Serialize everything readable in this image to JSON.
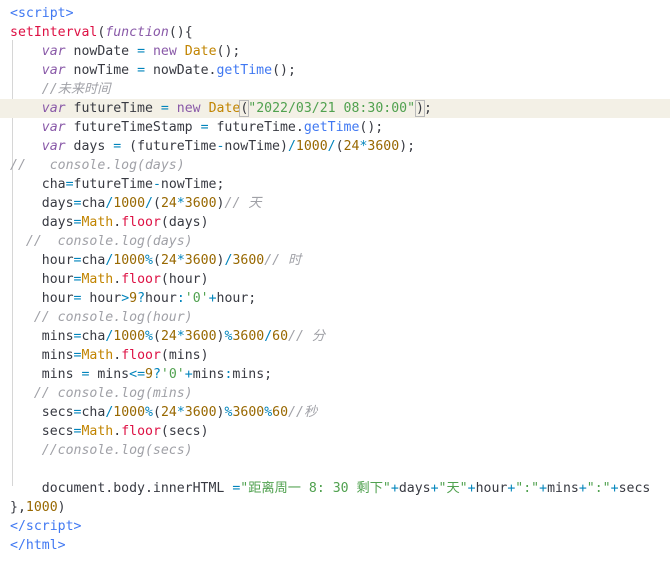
{
  "editor": {
    "language": "html",
    "cursor_line": 6,
    "lines": [
      [
        {
          "t": "<script>",
          "c": "tag"
        }
      ],
      [
        {
          "t": "setInterval",
          "c": "fn"
        },
        {
          "t": "(",
          "c": "plain"
        },
        {
          "t": "function",
          "c": "ital"
        },
        {
          "t": "(){",
          "c": "plain"
        }
      ],
      [
        {
          "t": "    ",
          "c": "plain"
        },
        {
          "t": "var",
          "c": "ital"
        },
        {
          "t": " nowDate ",
          "c": "plain"
        },
        {
          "t": "=",
          "c": "op"
        },
        {
          "t": " ",
          "c": "plain"
        },
        {
          "t": "new",
          "c": "kw"
        },
        {
          "t": " ",
          "c": "plain"
        },
        {
          "t": "Date",
          "c": "cls"
        },
        {
          "t": "();",
          "c": "plain"
        }
      ],
      [
        {
          "t": "    ",
          "c": "plain"
        },
        {
          "t": "var",
          "c": "ital"
        },
        {
          "t": " nowTime ",
          "c": "plain"
        },
        {
          "t": "=",
          "c": "op"
        },
        {
          "t": " nowDate.",
          "c": "plain"
        },
        {
          "t": "getTime",
          "c": "meth"
        },
        {
          "t": "();",
          "c": "plain"
        }
      ],
      [
        {
          "t": "    ",
          "c": "plain"
        },
        {
          "t": "//未来时间",
          "c": "cm"
        }
      ],
      [
        {
          "t": "    ",
          "c": "plain"
        },
        {
          "t": "var",
          "c": "ital"
        },
        {
          "t": " futureTime ",
          "c": "plain"
        },
        {
          "t": "=",
          "c": "op"
        },
        {
          "t": " ",
          "c": "plain"
        },
        {
          "t": "new",
          "c": "kw"
        },
        {
          "t": " ",
          "c": "plain"
        },
        {
          "t": "Date",
          "c": "cls"
        },
        {
          "t": "(",
          "c": "plain",
          "m": 1
        },
        {
          "t": "\"2022/03/21 08:30:00\"",
          "c": "str",
          "cursor": 1
        },
        {
          "t": ")",
          "c": "plain",
          "m": 1
        },
        {
          "t": ";",
          "c": "plain"
        }
      ],
      [
        {
          "t": "    ",
          "c": "plain"
        },
        {
          "t": "var",
          "c": "ital"
        },
        {
          "t": " futureTimeStamp ",
          "c": "plain"
        },
        {
          "t": "=",
          "c": "op"
        },
        {
          "t": " futureTime.",
          "c": "plain"
        },
        {
          "t": "getTime",
          "c": "meth"
        },
        {
          "t": "();",
          "c": "plain"
        }
      ],
      [
        {
          "t": "    ",
          "c": "plain"
        },
        {
          "t": "var",
          "c": "ital"
        },
        {
          "t": " days ",
          "c": "plain"
        },
        {
          "t": "=",
          "c": "op"
        },
        {
          "t": " (futureTime",
          "c": "plain"
        },
        {
          "t": "-",
          "c": "op"
        },
        {
          "t": "nowTime)",
          "c": "plain"
        },
        {
          "t": "/",
          "c": "op"
        },
        {
          "t": "1000",
          "c": "num"
        },
        {
          "t": "/",
          "c": "op"
        },
        {
          "t": "(",
          "c": "plain"
        },
        {
          "t": "24",
          "c": "num"
        },
        {
          "t": "*",
          "c": "op"
        },
        {
          "t": "3600",
          "c": "num"
        },
        {
          "t": ");",
          "c": "plain"
        }
      ],
      [
        {
          "t": "//   console.log(days)",
          "c": "cm"
        }
      ],
      [
        {
          "t": "    cha",
          "c": "plain"
        },
        {
          "t": "=",
          "c": "op"
        },
        {
          "t": "futureTime",
          "c": "plain"
        },
        {
          "t": "-",
          "c": "op"
        },
        {
          "t": "nowTime;",
          "c": "plain"
        }
      ],
      [
        {
          "t": "    days",
          "c": "plain"
        },
        {
          "t": "=",
          "c": "op"
        },
        {
          "t": "cha",
          "c": "plain"
        },
        {
          "t": "/",
          "c": "op"
        },
        {
          "t": "1000",
          "c": "num"
        },
        {
          "t": "/",
          "c": "op"
        },
        {
          "t": "(",
          "c": "plain"
        },
        {
          "t": "24",
          "c": "num"
        },
        {
          "t": "*",
          "c": "op"
        },
        {
          "t": "3600",
          "c": "num"
        },
        {
          "t": ")",
          "c": "plain"
        },
        {
          "t": "// 天",
          "c": "cm"
        }
      ],
      [
        {
          "t": "    days",
          "c": "plain"
        },
        {
          "t": "=",
          "c": "op"
        },
        {
          "t": "Math",
          "c": "cls"
        },
        {
          "t": ".",
          "c": "plain"
        },
        {
          "t": "floor",
          "c": "fn"
        },
        {
          "t": "(days)",
          "c": "plain"
        }
      ],
      [
        {
          "t": "  //  console.log(days)",
          "c": "cm"
        }
      ],
      [
        {
          "t": "    hour",
          "c": "plain"
        },
        {
          "t": "=",
          "c": "op"
        },
        {
          "t": "cha",
          "c": "plain"
        },
        {
          "t": "/",
          "c": "op"
        },
        {
          "t": "1000",
          "c": "num"
        },
        {
          "t": "%",
          "c": "op"
        },
        {
          "t": "(",
          "c": "plain"
        },
        {
          "t": "24",
          "c": "num"
        },
        {
          "t": "*",
          "c": "op"
        },
        {
          "t": "3600",
          "c": "num"
        },
        {
          "t": ")",
          "c": "plain"
        },
        {
          "t": "/",
          "c": "op"
        },
        {
          "t": "3600",
          "c": "num"
        },
        {
          "t": "// 时",
          "c": "cm"
        }
      ],
      [
        {
          "t": "    hour",
          "c": "plain"
        },
        {
          "t": "=",
          "c": "op"
        },
        {
          "t": "Math",
          "c": "cls"
        },
        {
          "t": ".",
          "c": "plain"
        },
        {
          "t": "floor",
          "c": "fn"
        },
        {
          "t": "(hour)",
          "c": "plain"
        }
      ],
      [
        {
          "t": "    hour",
          "c": "plain"
        },
        {
          "t": "=",
          "c": "op"
        },
        {
          "t": " hour",
          "c": "plain"
        },
        {
          "t": ">",
          "c": "op"
        },
        {
          "t": "9",
          "c": "num"
        },
        {
          "t": "?",
          "c": "op"
        },
        {
          "t": "hour",
          "c": "plain"
        },
        {
          "t": ":",
          "c": "op"
        },
        {
          "t": "'0'",
          "c": "str"
        },
        {
          "t": "+",
          "c": "op"
        },
        {
          "t": "hour;",
          "c": "plain"
        }
      ],
      [
        {
          "t": "   // console.log(hour)",
          "c": "cm"
        }
      ],
      [
        {
          "t": "    mins",
          "c": "plain"
        },
        {
          "t": "=",
          "c": "op"
        },
        {
          "t": "cha",
          "c": "plain"
        },
        {
          "t": "/",
          "c": "op"
        },
        {
          "t": "1000",
          "c": "num"
        },
        {
          "t": "%",
          "c": "op"
        },
        {
          "t": "(",
          "c": "plain"
        },
        {
          "t": "24",
          "c": "num"
        },
        {
          "t": "*",
          "c": "op"
        },
        {
          "t": "3600",
          "c": "num"
        },
        {
          "t": ")",
          "c": "plain"
        },
        {
          "t": "%",
          "c": "op"
        },
        {
          "t": "3600",
          "c": "num"
        },
        {
          "t": "/",
          "c": "op"
        },
        {
          "t": "60",
          "c": "num"
        },
        {
          "t": "// 分",
          "c": "cm"
        }
      ],
      [
        {
          "t": "    mins",
          "c": "plain"
        },
        {
          "t": "=",
          "c": "op"
        },
        {
          "t": "Math",
          "c": "cls"
        },
        {
          "t": ".",
          "c": "plain"
        },
        {
          "t": "floor",
          "c": "fn"
        },
        {
          "t": "(mins)",
          "c": "plain"
        }
      ],
      [
        {
          "t": "    mins ",
          "c": "plain"
        },
        {
          "t": "=",
          "c": "op"
        },
        {
          "t": " mins",
          "c": "plain"
        },
        {
          "t": "<=",
          "c": "op"
        },
        {
          "t": "9",
          "c": "num"
        },
        {
          "t": "?",
          "c": "op"
        },
        {
          "t": "'0'",
          "c": "str"
        },
        {
          "t": "+",
          "c": "op"
        },
        {
          "t": "mins",
          "c": "plain"
        },
        {
          "t": ":",
          "c": "op"
        },
        {
          "t": "mins;",
          "c": "plain"
        }
      ],
      [
        {
          "t": "   // console.log(mins)",
          "c": "cm"
        }
      ],
      [
        {
          "t": "    secs",
          "c": "plain"
        },
        {
          "t": "=",
          "c": "op"
        },
        {
          "t": "cha",
          "c": "plain"
        },
        {
          "t": "/",
          "c": "op"
        },
        {
          "t": "1000",
          "c": "num"
        },
        {
          "t": "%",
          "c": "op"
        },
        {
          "t": "(",
          "c": "plain"
        },
        {
          "t": "24",
          "c": "num"
        },
        {
          "t": "*",
          "c": "op"
        },
        {
          "t": "3600",
          "c": "num"
        },
        {
          "t": ")",
          "c": "plain"
        },
        {
          "t": "%",
          "c": "op"
        },
        {
          "t": "3600",
          "c": "num"
        },
        {
          "t": "%",
          "c": "op"
        },
        {
          "t": "60",
          "c": "num"
        },
        {
          "t": "//秒",
          "c": "cm"
        }
      ],
      [
        {
          "t": "    secs",
          "c": "plain"
        },
        {
          "t": "=",
          "c": "op"
        },
        {
          "t": "Math",
          "c": "cls"
        },
        {
          "t": ".",
          "c": "plain"
        },
        {
          "t": "floor",
          "c": "fn"
        },
        {
          "t": "(secs)",
          "c": "plain"
        }
      ],
      [
        {
          "t": "    //console.log(secs)",
          "c": "cm"
        }
      ],
      [],
      [
        {
          "t": "    document.body.innerHTML ",
          "c": "plain"
        },
        {
          "t": "=",
          "c": "op"
        },
        {
          "t": "\"距离周一 8: 30 剩下\"",
          "c": "str"
        },
        {
          "t": "+",
          "c": "op"
        },
        {
          "t": "days",
          "c": "plain"
        },
        {
          "t": "+",
          "c": "op"
        },
        {
          "t": "\"天\"",
          "c": "str"
        },
        {
          "t": "+",
          "c": "op"
        },
        {
          "t": "hour",
          "c": "plain"
        },
        {
          "t": "+",
          "c": "op"
        },
        {
          "t": "\":\"",
          "c": "str"
        },
        {
          "t": "+",
          "c": "op"
        },
        {
          "t": "mins",
          "c": "plain"
        },
        {
          "t": "+",
          "c": "op"
        },
        {
          "t": "\":\"",
          "c": "str"
        },
        {
          "t": "+",
          "c": "op"
        },
        {
          "t": "secs",
          "c": "plain"
        }
      ],
      [
        {
          "t": "},",
          "c": "plain"
        },
        {
          "t": "1000",
          "c": "num"
        },
        {
          "t": ")",
          "c": "plain"
        }
      ],
      [
        {
          "t": "</",
          "c": "tag"
        },
        {
          "t": "script",
          "c": "tag"
        },
        {
          "t": ">",
          "c": "tag"
        }
      ],
      [
        {
          "t": "</",
          "c": "tag"
        },
        {
          "t": "html",
          "c": "tag"
        },
        {
          "t": ">",
          "c": "tag"
        }
      ]
    ]
  }
}
